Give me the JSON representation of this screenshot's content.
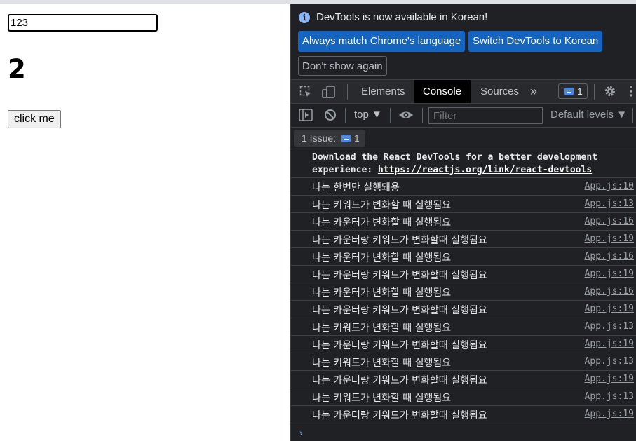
{
  "page": {
    "input_value": "123",
    "counter": "2",
    "button_label": "click me"
  },
  "devtools": {
    "infobar": {
      "message": "DevTools is now available in Korean!",
      "btn_match": "Always match Chrome's language",
      "btn_switch": "Switch DevTools to Korean",
      "btn_dismiss": "Don't show again"
    },
    "tabs": {
      "elements": "Elements",
      "console": "Console",
      "sources": "Sources",
      "more": "»",
      "messages_count": "1"
    },
    "toolbar": {
      "context": "top ▼",
      "filter_placeholder": "Filter",
      "levels": "Default levels ▼"
    },
    "issues": {
      "label": "1 Issue:",
      "count": "1"
    },
    "console": {
      "head_line1": "Download the React DevTools for a better development",
      "head_line2_prefix": "experience: ",
      "head_link": "https://reactjs.org/link/react-devtools",
      "rows": [
        {
          "msg": "나는 한번만 실행돼용",
          "src": "App.js:10"
        },
        {
          "msg": "나는 키워드가 변화할 때 실행됨요",
          "src": "App.js:13"
        },
        {
          "msg": "나는 카운터가 변화할 때 실행됨요",
          "src": "App.js:16"
        },
        {
          "msg": "나는 카운터랑 키워드가 변화할때 실행됨요",
          "src": "App.js:19"
        },
        {
          "msg": "나는 카운터가 변화할 때 실행됨요",
          "src": "App.js:16"
        },
        {
          "msg": "나는 카운터랑 키워드가 변화할때 실행됨요",
          "src": "App.js:19"
        },
        {
          "msg": "나는 카운터가 변화할 때 실행됨요",
          "src": "App.js:16"
        },
        {
          "msg": "나는 카운터랑 키워드가 변화할때 실행됨요",
          "src": "App.js:19"
        },
        {
          "msg": "나는 키워드가 변화할 때 실행됨요",
          "src": "App.js:13"
        },
        {
          "msg": "나는 카운터랑 키워드가 변화할때 실행됨요",
          "src": "App.js:19"
        },
        {
          "msg": "나는 키워드가 변화할 때 실행됨요",
          "src": "App.js:13"
        },
        {
          "msg": "나는 카운터랑 키워드가 변화할때 실행됨요",
          "src": "App.js:19"
        },
        {
          "msg": "나는 키워드가 변화할 때 실행됨요",
          "src": "App.js:13"
        },
        {
          "msg": "나는 카운터랑 키워드가 변화할때 실행됨요",
          "src": "App.js:19"
        }
      ],
      "prompt": "›"
    }
  }
}
